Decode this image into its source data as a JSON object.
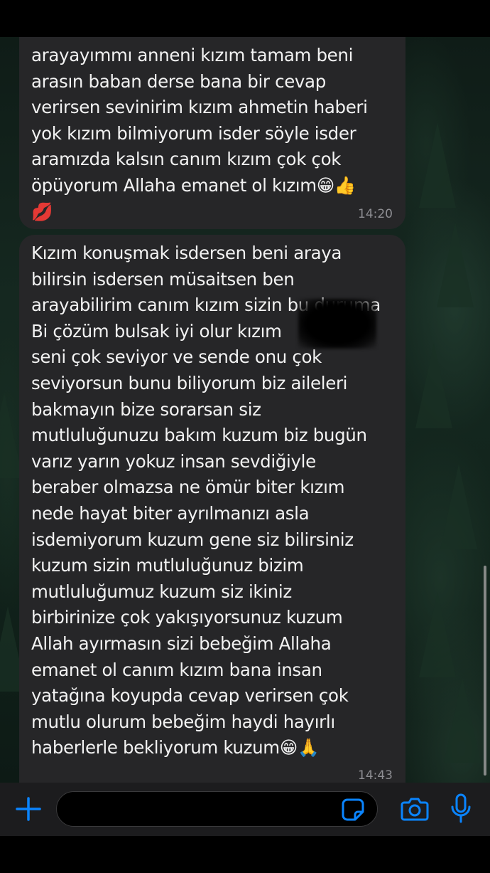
{
  "messages": [
    {
      "text": "arayayımmı anneni kızım tamam beni\narasın baban derse bana bir cevap\nverirsen sevinirim kızım ahmetin haberi\nyok kızım bilmiyorum isder söyle isder\naramızda kalsın canım kızım çok çok\nöpüyorum Allaha emanet ol kızım😁👍\n💋",
      "time": "14:20"
    },
    {
      "text": "Kızım konuşmak isdersen beni araya\nbilirsin isdersen müsaitsen ben\narayabilirim canım kızım sizin bu duruma\nBi çözüm bulsak iyi olur kızım\nseni çok seviyor ve sende onu çok\nseviyorsun bunu biliyorum biz aileleri\nbakmayın bize sorarsan siz\nmutluluğunuzu bakım kuzum biz bugün\nvarız yarın yokuz insan sevdiğiyle\nberaber olmazsa ne ömür biter kızım\nnede hayat biter ayrılmanızı asla\nisdemiyorum kuzum gene siz bilirsiniz\nkuzum sizin mutluluğunuz bizim\nmutluluğumuz kuzum siz ikiniz\nbirbirinize çok yakışıyorsunuz kuzum\nAllah ayırmasın sizi bebeğim Allaha\nemanet ol canım kızım bana insan\nyatağına koyupda cevap verirsen çok\nmutlu olurum bebeğim haydi hayırlı\nhaberlerle bekliyorum kuzum😁🙏",
      "time": "14:43"
    }
  ],
  "input_bar": {
    "placeholder": ""
  },
  "colors": {
    "accent": "#0a84ff",
    "bubble": "#262628",
    "timestamp": "#8e8e93"
  },
  "icons": {
    "plus": "plus-icon",
    "sticker": "sticker-icon",
    "camera": "camera-icon",
    "mic": "microphone-icon"
  }
}
